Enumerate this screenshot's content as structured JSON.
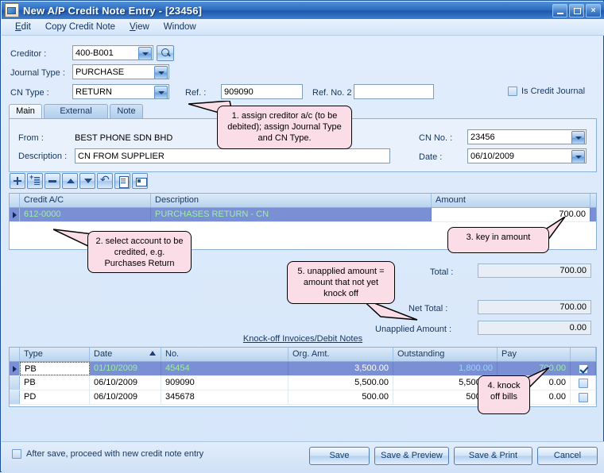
{
  "window": {
    "title": "New A/P Credit Note Entry - [23456]",
    "icon": "document-app-icon",
    "controls": {
      "minimize": "minimize-icon",
      "maximize": "maximize-icon",
      "close": "×"
    }
  },
  "menubar": {
    "items": [
      {
        "label": "Edit",
        "mnemonic": "E"
      },
      {
        "label": "Copy Credit Note",
        "mnemonic": ""
      },
      {
        "label": "View",
        "mnemonic": "V"
      },
      {
        "label": "Window",
        "mnemonic": ""
      }
    ]
  },
  "header": {
    "creditor_label": "Creditor :",
    "creditor_value": "400-B001",
    "search_icon": "magnifier-icon",
    "journal_type_label": "Journal Type :",
    "journal_type_value": "PURCHASE",
    "cn_type_label": "CN Type :",
    "cn_type_value": "RETURN",
    "ref_label": "Ref. :",
    "ref_value": "909090",
    "ref2_label": "Ref. No. 2 :",
    "ref2_value": "",
    "is_credit_journal_label": "Is Credit Journal",
    "is_credit_journal_checked": false
  },
  "tabs": [
    {
      "label": "Main",
      "active": true
    },
    {
      "label": "External Links",
      "active": false
    },
    {
      "label": "Note",
      "active": false
    }
  ],
  "main_panel": {
    "from_label": "From :",
    "from_value": "BEST PHONE SDN BHD",
    "description_label": "Description :",
    "description_value": "CN FROM SUPPLIER",
    "cn_no_label": "CN No. :",
    "cn_no_value": "23456",
    "date_label": "Date :",
    "date_value": "06/10/2009"
  },
  "row_toolbar": [
    {
      "name": "add-row-button",
      "icon": "plus-icon"
    },
    {
      "name": "insert-row-button",
      "icon": "plus-lines-icon"
    },
    {
      "name": "delete-row-button",
      "icon": "minus-icon"
    },
    {
      "name": "move-up-button",
      "icon": "arrow-up-icon"
    },
    {
      "name": "move-down-button",
      "icon": "arrow-down-icon"
    },
    {
      "name": "undo-button",
      "icon": "undo-arrow-icon"
    },
    {
      "name": "detail-view-button",
      "icon": "document-lines-icon"
    },
    {
      "name": "layout-button",
      "icon": "document-card-icon"
    }
  ],
  "credit_grid": {
    "columns": [
      "Credit A/C",
      "Description",
      "Amount"
    ],
    "rows": [
      {
        "selected": true,
        "credit_ac": "612-0000",
        "description": "PURCHASES RETURN - CN",
        "amount": "700.00"
      }
    ]
  },
  "totals": {
    "total_label": "Total :",
    "total_value": "700.00",
    "net_total_label": "Net Total  :",
    "net_total_value": "700.00",
    "unapplied_label": "Unapplied Amount :",
    "unapplied_value": "0.00"
  },
  "knockoff": {
    "title": "Knock-off Invoices/Debit Notes",
    "columns": [
      "Type",
      "Date",
      "No.",
      "Org. Amt.",
      "Outstanding",
      "Pay",
      ""
    ],
    "sorted_column": "Date",
    "sort_direction": "asc",
    "rows": [
      {
        "selected": true,
        "type": "PB",
        "date": "01/10/2009",
        "no": "45454",
        "org_amt": "3,500.00",
        "outstanding": "1,800.00",
        "pay": "700.00",
        "checked": true
      },
      {
        "selected": false,
        "type": "PB",
        "date": "06/10/2009",
        "no": "909090",
        "org_amt": "5,500.00",
        "outstanding": "5,500.00",
        "pay": "0.00",
        "checked": false
      },
      {
        "selected": false,
        "type": "PD",
        "date": "06/10/2009",
        "no": "345678",
        "org_amt": "500.00",
        "outstanding": "500.00",
        "pay": "0.00",
        "checked": false
      }
    ]
  },
  "footer": {
    "after_save_label": "After save, proceed with new credit note entry",
    "after_save_checked": false,
    "save_label": "Save",
    "save_preview_label": "Save & Preview",
    "save_print_label": "Save & Print",
    "cancel_label": "Cancel"
  },
  "callouts": {
    "c1": "1. assign creditor a/c (to be debited); assign Journal Type and CN Type.",
    "c2": "2. select account to be credited, e.g. Purchases Return",
    "c3": "3. key in amount",
    "c4": "4. knock off bills",
    "c5": "5. unapplied amount = amount that not yet knock off"
  },
  "colors": {
    "titlebar": "#2f6cc0",
    "form_bg": "#dfeafb",
    "selection": "#7b8fd4",
    "selection_text": "#9bf0a0",
    "callout_bg": "#fbdde8",
    "label_text": "#17365d"
  }
}
